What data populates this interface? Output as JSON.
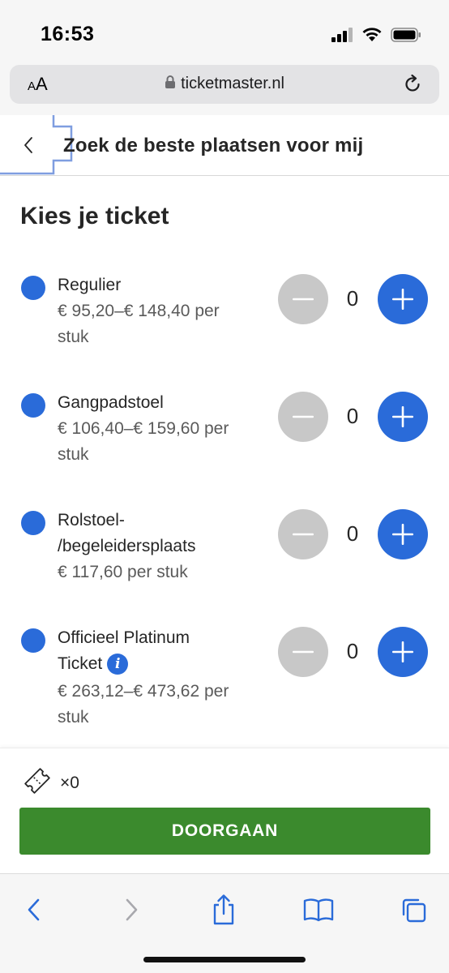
{
  "status_bar": {
    "time": "16:53"
  },
  "browser": {
    "text_size_label_small": "A",
    "text_size_label_large": "A",
    "url": "ticketmaster.nl",
    "icons": [
      "lock-icon",
      "reload-icon",
      "signal-icon",
      "wifi-icon",
      "battery-icon"
    ]
  },
  "header": {
    "title": "Zoek de beste plaatsen voor mij"
  },
  "main": {
    "section_title": "Kies je ticket",
    "tickets": [
      {
        "name": "Regulier",
        "price_line1": "€ 95,20–€ 148,40 per",
        "price_line2": "stuk",
        "quantity": "0"
      },
      {
        "name": "Gangpadstoel",
        "price_line1": "€ 106,40–€ 159,60 per",
        "price_line2": "stuk",
        "quantity": "0"
      },
      {
        "name_line1": "Rolstoel-",
        "name_line2": "/begeleidersplaats",
        "price_line1": "€ 117,60 per stuk",
        "quantity": "0"
      },
      {
        "name_line1": "Officieel Platinum",
        "name_line2": "Ticket",
        "info_glyph": "i",
        "price_line1": "€ 263,12–€ 473,62 per",
        "price_line2": "stuk",
        "quantity": "0"
      }
    ]
  },
  "footer": {
    "ticket_count": "×0",
    "continue_label": "DOORGAAN"
  },
  "toolbar": {
    "items": [
      "back-icon",
      "forward-icon",
      "share-icon",
      "bookmarks-icon",
      "tabs-icon"
    ]
  },
  "colors": {
    "accent": "#2a6bd9",
    "continue": "#3b8a2d",
    "disabled": "#c8c8c8",
    "text": "#262626"
  }
}
